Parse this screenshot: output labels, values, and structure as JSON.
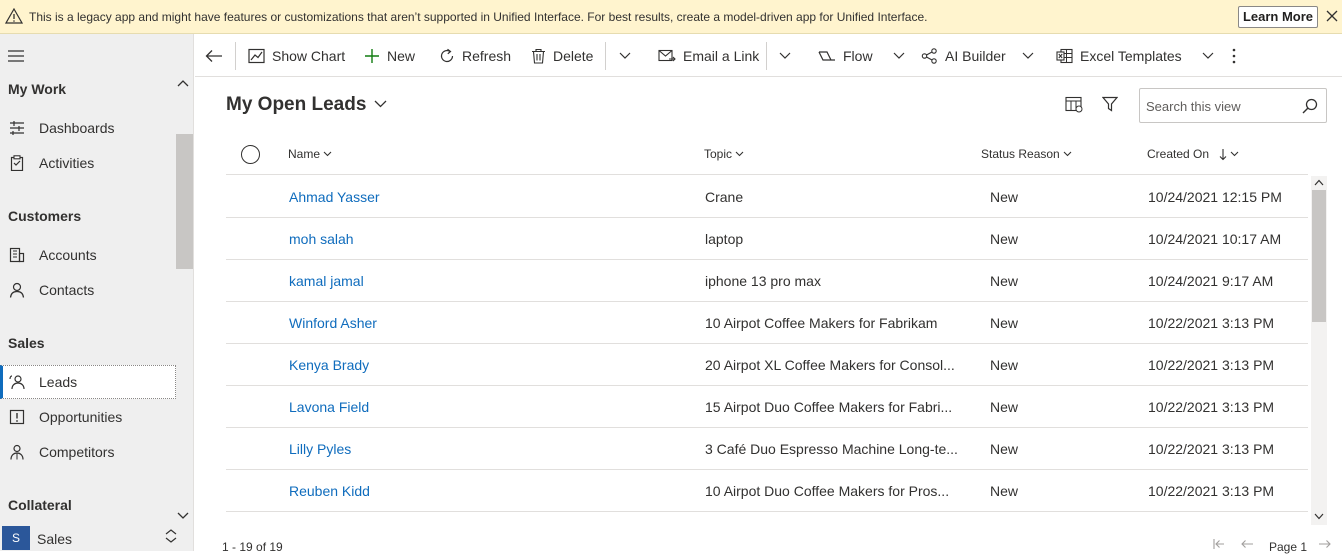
{
  "banner": {
    "message": "This is a legacy app and might have features or customizations that aren’t supported in Unified Interface. For best results, create a model-driven app for Unified Interface.",
    "learn_more": "Learn More"
  },
  "sidebar": {
    "sections": [
      {
        "title": "My Work",
        "items": [
          {
            "label": "Dashboards",
            "icon": "dashboard-icon"
          },
          {
            "label": "Activities",
            "icon": "activities-icon"
          }
        ]
      },
      {
        "title": "Customers",
        "items": [
          {
            "label": "Accounts",
            "icon": "accounts-icon"
          },
          {
            "label": "Contacts",
            "icon": "contacts-icon"
          }
        ]
      },
      {
        "title": "Sales",
        "items": [
          {
            "label": "Leads",
            "icon": "leads-icon"
          },
          {
            "label": "Opportunities",
            "icon": "opportunities-icon"
          },
          {
            "label": "Competitors",
            "icon": "competitors-icon"
          }
        ]
      },
      {
        "title": "Collateral",
        "items": []
      }
    ],
    "active_item": "Leads",
    "area": {
      "badge": "S",
      "label": "Sales"
    }
  },
  "commandbar": {
    "show_chart": "Show Chart",
    "new": "New",
    "refresh": "Refresh",
    "delete": "Delete",
    "email_link": "Email a Link",
    "flow": "Flow",
    "ai_builder": "AI Builder",
    "excel_templates": "Excel Templates"
  },
  "view": {
    "title": "My Open Leads",
    "search_placeholder": "Search this view"
  },
  "grid": {
    "columns": [
      "Name",
      "Topic",
      "Status Reason",
      "Created On"
    ],
    "rows": [
      {
        "name": "Ahmad Yasser",
        "topic": "Crane",
        "status": "New",
        "created": "10/24/2021 12:15 PM"
      },
      {
        "name": "moh salah",
        "topic": "laptop",
        "status": "New",
        "created": "10/24/2021 10:17 AM"
      },
      {
        "name": "kamal jamal",
        "topic": "iphone 13 pro max",
        "status": "New",
        "created": "10/24/2021 9:17 AM"
      },
      {
        "name": "Winford Asher",
        "topic": "10 Airpot Coffee Makers for Fabrikam",
        "status": "New",
        "created": "10/22/2021 3:13 PM"
      },
      {
        "name": "Kenya Brady",
        "topic": "20 Airpot XL Coffee Makers for Consol...",
        "status": "New",
        "created": "10/22/2021 3:13 PM"
      },
      {
        "name": "Lavona Field",
        "topic": "15 Airpot Duo Coffee Makers for Fabri...",
        "status": "New",
        "created": "10/22/2021 3:13 PM"
      },
      {
        "name": "Lilly Pyles",
        "topic": "3 Café Duo Espresso Machine Long-te...",
        "status": "New",
        "created": "10/22/2021 3:13 PM"
      },
      {
        "name": "Reuben Kidd",
        "topic": "10 Airpot Duo Coffee Makers for Pros...",
        "status": "New",
        "created": "10/22/2021 3:13 PM"
      }
    ]
  },
  "footer": {
    "count": "1 - 19 of 19",
    "page": "Page 1"
  },
  "colors": {
    "accent": "#0f6cbd",
    "banner_bg": "#fff4ce",
    "sidebar_bg": "#efefef"
  }
}
